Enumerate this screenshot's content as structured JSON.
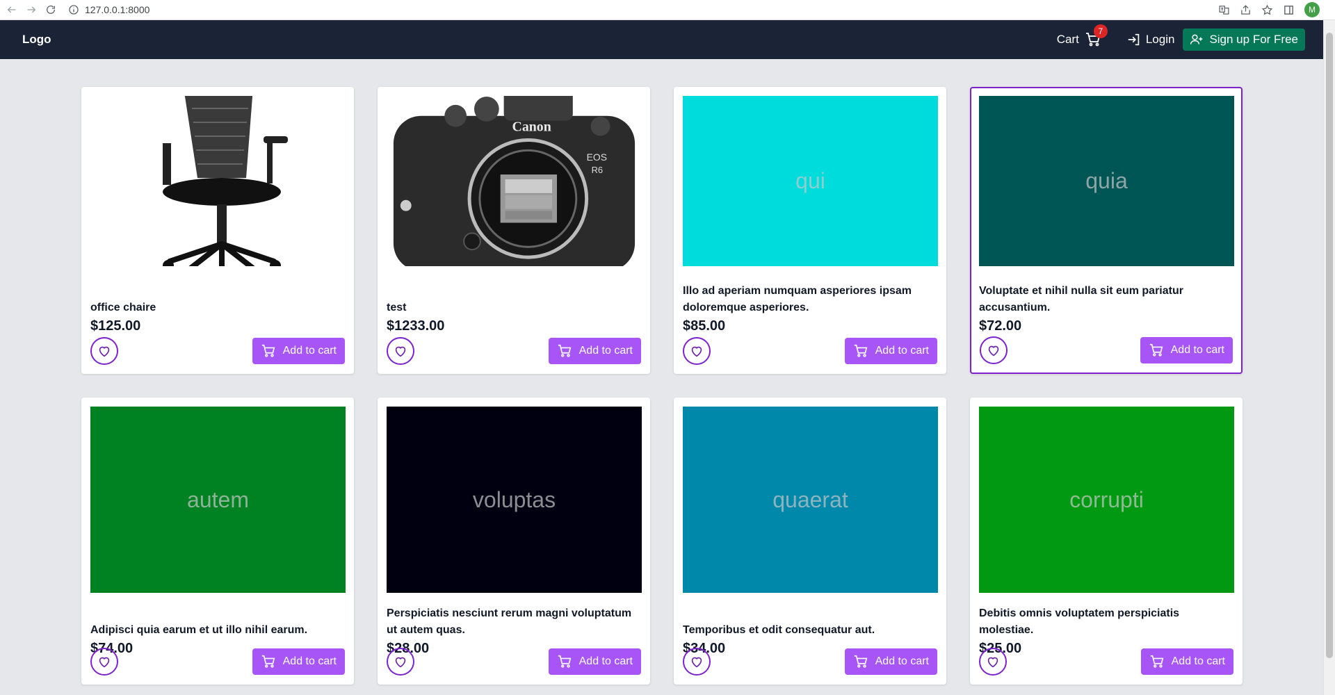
{
  "browser": {
    "url": "127.0.0.1:8000",
    "profile_initial": "M"
  },
  "nav": {
    "logo": "Logo",
    "cart_label": "Cart",
    "cart_count": "7",
    "login_label": "Login",
    "signup_label": "Sign up For Free"
  },
  "products": [
    {
      "title": "office chaire",
      "price": "$125.00",
      "image": "office-chair-photo",
      "placeholder_text": "",
      "bg": "#ffffff"
    },
    {
      "title": "test",
      "price": "$1233.00",
      "image": "camera-photo",
      "placeholder_text": "",
      "bg": "#ffffff"
    },
    {
      "title": "Illo ad aperiam numquam asperiores ipsam doloremque asperiores.",
      "price": "$85.00",
      "image": "placeholder",
      "placeholder_text": "qui",
      "bg": "#00dcdc"
    },
    {
      "title": "Voluptate et nihil nulla sit eum pariatur accusantium.",
      "price": "$72.00",
      "image": "placeholder",
      "placeholder_text": "quia",
      "bg": "#005555"
    },
    {
      "title": "Adipisci quia earum et ut illo nihil earum.",
      "price": "$74.00",
      "image": "placeholder",
      "placeholder_text": "autem",
      "bg": "#008222"
    },
    {
      "title": "Perspiciatis nesciunt rerum magni voluptatum ut autem quas.",
      "price": "$28.00",
      "image": "placeholder",
      "placeholder_text": "voluptas",
      "bg": "#000011"
    },
    {
      "title": "Temporibus et odit consequatur aut.",
      "price": "$34.00",
      "image": "placeholder",
      "placeholder_text": "quaerat",
      "bg": "#0088aa"
    },
    {
      "title": "Debitis omnis voluptatem perspiciatis molestiae.",
      "price": "$25.00",
      "image": "placeholder",
      "placeholder_text": "corrupti",
      "bg": "#009911"
    }
  ],
  "add_to_cart_label": "Add to cart"
}
